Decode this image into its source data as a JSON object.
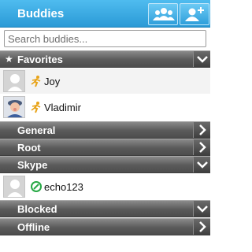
{
  "header": {
    "title": "Buddies",
    "icons": [
      "group-icon",
      "add-buddy-icon"
    ]
  },
  "search": {
    "placeholder": "Search buddies...",
    "value": ""
  },
  "groups": {
    "favorites": {
      "label": "Favorites",
      "icon": "star-icon",
      "expanded": true
    },
    "general": {
      "label": "General",
      "expanded": false
    },
    "root": {
      "label": "Root",
      "expanded": false
    },
    "skype": {
      "label": "Skype",
      "expanded": true
    },
    "blocked": {
      "label": "Blocked",
      "expanded": true
    },
    "offline": {
      "label": "Offline",
      "expanded": false
    }
  },
  "contacts": {
    "joy": {
      "name": "Joy",
      "status_icon": "running-man-icon",
      "avatar": "default-avatar"
    },
    "vladimir": {
      "name": "Vladimir",
      "status_icon": "running-man-icon",
      "avatar": "photo-avatar"
    },
    "echo123": {
      "name": "echo123",
      "status_icon": "skype-icon",
      "avatar": "default-avatar"
    }
  },
  "colors": {
    "header": "#2a9ad6",
    "group_bar": "#5a5a5a",
    "skype": "#27a845",
    "status_yellow": "#e8a317"
  }
}
